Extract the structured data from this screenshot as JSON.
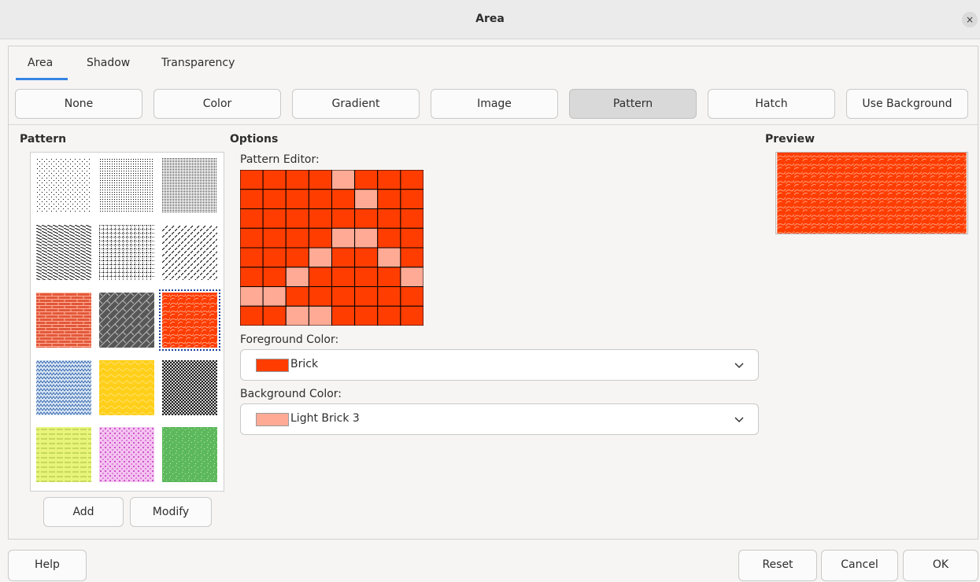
{
  "window": {
    "title": "Area",
    "close_glyph": "×"
  },
  "tabs": [
    {
      "label": "Area",
      "active": true
    },
    {
      "label": "Shadow",
      "active": false
    },
    {
      "label": "Transparency",
      "active": false
    }
  ],
  "fill_types": [
    {
      "label": "None",
      "active": false
    },
    {
      "label": "Color",
      "active": false
    },
    {
      "label": "Gradient",
      "active": false
    },
    {
      "label": "Image",
      "active": false
    },
    {
      "label": "Pattern",
      "active": true
    },
    {
      "label": "Hatch",
      "active": false
    },
    {
      "label": "Use Background",
      "active": false
    }
  ],
  "pattern_panel": {
    "heading": "Pattern",
    "selected_index": 8,
    "add_label": "Add",
    "modify_label": "Modify"
  },
  "options": {
    "heading": "Options",
    "editor_label": "Pattern Editor:",
    "foreground_label": "Foreground Color:",
    "foreground_value": "Brick",
    "foreground_color": "#ff3d00",
    "background_label": "Background Color:",
    "background_value": "Light Brick 3",
    "background_color": "#ffaa95"
  },
  "preview": {
    "heading": "Preview"
  },
  "footer": {
    "help_label": "Help",
    "reset_label": "Reset",
    "cancel_label": "Cancel",
    "ok_label": "OK"
  },
  "icons": {
    "close": "close-icon",
    "chevron": "chevron-down-icon"
  },
  "colors": {
    "accent": "#3584e4",
    "brick": "#ff3d00",
    "light_brick": "#ffaa95"
  }
}
